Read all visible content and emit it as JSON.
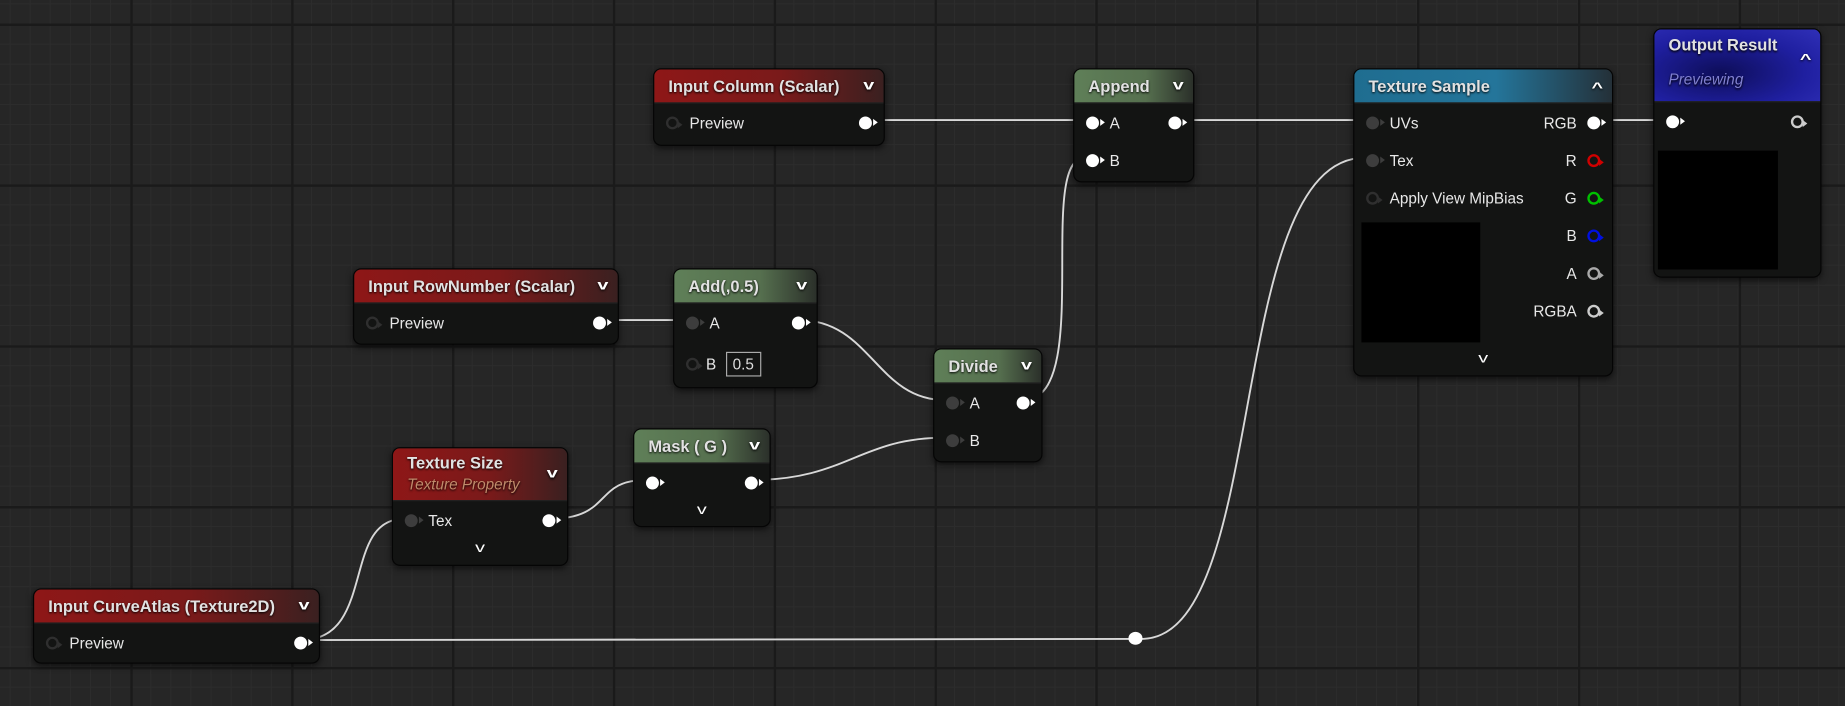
{
  "colors": {
    "input_header": "#8e1717",
    "math_header": "#5f7f58",
    "texture_header": "#1f6d90",
    "output_header": "#1f1fa0",
    "wire": "#d8d8d8",
    "pin_r": "#d00000",
    "pin_g": "#00c000",
    "pin_b": "#0010e0"
  },
  "nodes": {
    "input_column": {
      "title": "Input Column (Scalar)",
      "pin": "Preview"
    },
    "append": {
      "title": "Append",
      "pin_a": "A",
      "pin_b": "B"
    },
    "texture_sample": {
      "title": "Texture Sample",
      "inputs": [
        "UVs",
        "Tex",
        "Apply View MipBias"
      ],
      "outputs": [
        "RGB",
        "R",
        "G",
        "B",
        "A",
        "RGBA"
      ]
    },
    "output_result": {
      "title": "Output Result",
      "subtitle": "Previewing"
    },
    "input_rownumber": {
      "title": "Input RowNumber (Scalar)",
      "pin": "Preview"
    },
    "add": {
      "title": "Add(,0.5)",
      "pin_a": "A",
      "pin_b": "B",
      "b_value": "0.5"
    },
    "divide": {
      "title": "Divide",
      "pin_a": "A",
      "pin_b": "B"
    },
    "mask": {
      "title": "Mask ( G )"
    },
    "texture_size": {
      "title": "Texture Size",
      "subtitle": "Texture Property",
      "pin": "Tex"
    },
    "input_curveatlas": {
      "title": "Input CurveAtlas (Texture2D)",
      "pin": "Preview"
    }
  },
  "icons": {
    "collapse": "chevron-down-icon",
    "expand": "chevron-up-icon"
  }
}
